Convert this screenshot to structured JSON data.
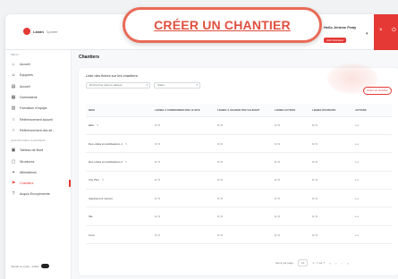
{
  "header": {
    "logo_brand": "Lanan",
    "logo_product": "Spotter",
    "user_name": "Hello Jérôme Praty",
    "user_role": "Administrateur"
  },
  "sidebar": {
    "section_main": "MENU",
    "items_top": [
      {
        "label": "Accueil",
        "icon": "home-icon"
      },
      {
        "label": "Equipiers",
        "icon": "users-icon"
      },
      {
        "label": "Accueil",
        "icon": "doc-icon"
      },
      {
        "label": "Gammaterie",
        "icon": "grid-icon"
      },
      {
        "label": "Formation d'équipe",
        "icon": "chart-icon"
      },
      {
        "label": "Référencement accueil",
        "icon": "circle-icon"
      },
      {
        "label": "Référencement des sit...",
        "icon": "circle-icon"
      }
    ],
    "section_secondary": "GESTION DES CHANTIERS",
    "items_bottom": [
      {
        "label": "Tableau de Bord",
        "icon": "dashboard-icon",
        "active": false
      },
      {
        "label": "Structures",
        "icon": "building-icon",
        "active": false
      },
      {
        "label": "Affectations",
        "icon": "pin-icon",
        "active": false
      },
      {
        "label": "Chantiers",
        "icon": "flag-icon",
        "active": true
      },
      {
        "label": "Acquis Envoyements",
        "icon": "help-icon",
        "active": false
      }
    ],
    "footer_label": "Vanitar te mode - Juillet"
  },
  "main": {
    "page_title": "Chantiers",
    "card_title": "Liste des fiches sur les chantiers",
    "filter_status": "Rechercher dans le tableau",
    "filter_period": "Statut",
    "create_small": "Créer un chantier",
    "columns": [
      "NOM",
      "LIGNES À COMMANDER PAR LE SITE",
      "LIGNES À VALIDER PAR VALIDANT",
      "LIGNES ACTIVES",
      "LIGNES ÉTAPEURS",
      "ACTIONS"
    ],
    "rows": [
      {
        "name": "Elbé",
        "c1": "0 / 0",
        "c2": "0 / 0",
        "c3": "0 / 0",
        "c4": "0 / 0",
        "action": "•••"
      },
      {
        "name": "Des unités immobilisations 1",
        "c1": "0 / 0",
        "c2": "0 / 0",
        "c3": "0 / 0",
        "c4": "0 / 0",
        "action": "•••"
      },
      {
        "name": "Des unités immobilisations 2",
        "c1": "0 / 0",
        "c2": "0 / 0",
        "c3": "0 / 0",
        "c4": "0 / 0",
        "action": "•••"
      },
      {
        "name": "City Plus",
        "c1": "0 / 0",
        "c2": "0 / 0",
        "c3": "0 / 0",
        "c4": "0 / 0",
        "action": "•••"
      },
      {
        "name": "Apparement neuves",
        "c1": "0 / 0",
        "c2": "0 / 0",
        "c3": "0 / 0",
        "c4": "0 / 0",
        "action": "•••"
      },
      {
        "name": "Ibis",
        "c1": "0 / 0",
        "c2": "0 / 0",
        "c3": "0 / 0",
        "c4": "0 / 0",
        "action": "•••"
      },
      {
        "name": "Lime",
        "c1": "0 / 0",
        "c2": "0 / 0",
        "c3": "0 / 0",
        "c4": "0 / 0",
        "action": "•••"
      }
    ],
    "pager": {
      "rows_label": "Items par page",
      "rows_value": "10",
      "range": "1 - 7 sur 7"
    }
  },
  "callout": {
    "button_label": "CRÉER UN CHANTIER"
  },
  "colors": {
    "accent": "#e53935",
    "callout_border": "#e96a57",
    "callout_text": "#e04f3e"
  }
}
